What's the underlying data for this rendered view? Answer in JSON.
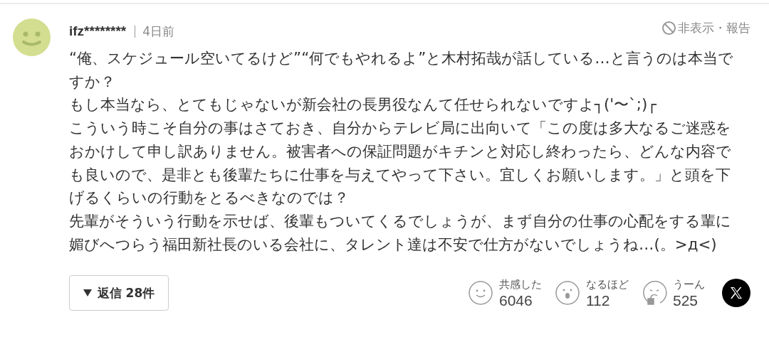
{
  "comment": {
    "username": "ifz********",
    "time": "4日前",
    "hide_report": "非表示・報告",
    "paragraphs": [
      "“俺、スケジュール空いてるけど”“何でもやれるよ”と木村拓哉が話している…と言うのは本当ですか？",
      "もし本当なら、とてもじゃないが新会社の長男役なんて任せられないですよ┐('〜`;)┌",
      "こういう時こそ自分の事はさておき、自分からテレビ局に出向いて「この度は多大なるご迷惑をおかけして申し訳ありません。被害者への保証問題がキチンと対応し終わったら、どんな内容でも良いので、是非とも後輩たちに仕事を与えてやって下さい。宜しくお願いします。」と頭を下げるくらいの行動をとるべきなのでは？",
      "先輩がそういう行動を示せば、後輩もついてくるでしょうが、まず自分の仕事の心配をする輩に媚びへつらう福田新社長のいる会社に、タレント達は不安で仕方がないでしょうね…(。>д<)"
    ],
    "replies_button": "返信 28件",
    "reactions": [
      {
        "kind": "smile",
        "label": "共感した",
        "count": "6046"
      },
      {
        "kind": "surprised",
        "label": "なるほど",
        "count": "112"
      },
      {
        "kind": "hmm",
        "label": "うーん",
        "count": "525"
      }
    ]
  }
}
